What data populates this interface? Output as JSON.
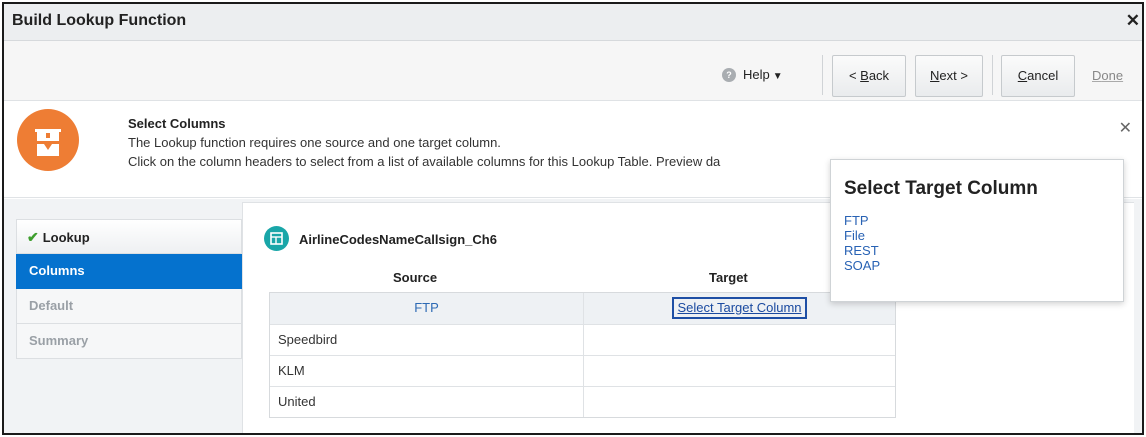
{
  "dialog": {
    "title": "Build Lookup Function",
    "close_glyph": "✕"
  },
  "toolbar": {
    "help_label": "Help",
    "back": {
      "accel": "B",
      "prefix": "< ",
      "rest": "ack"
    },
    "next": {
      "accel": "N",
      "rest": "ext >"
    },
    "cancel": {
      "accel": "C",
      "rest": "ancel"
    },
    "done": {
      "accel": "D",
      "rest": "one"
    }
  },
  "info": {
    "title": "Select Columns",
    "line1": "The Lookup function requires one source and one target column.",
    "line2": "Click on the column headers to select from a list of available columns for this Lookup Table. Preview da",
    "close_glyph": "✕",
    "badge_color": "#ee7d34"
  },
  "steps": [
    {
      "label": "Lookup",
      "state": "completed"
    },
    {
      "label": "Columns",
      "state": "active"
    },
    {
      "label": "Default",
      "state": "pending"
    },
    {
      "label": "Summary",
      "state": "pending"
    }
  ],
  "content": {
    "table_name": "AirlineCodesNameCallsign_Ch6",
    "source_header": "Source",
    "target_header": "Target",
    "source_column": "FTP",
    "target_column": "Select Target Column",
    "rows": [
      {
        "source": "Speedbird",
        "target": ""
      },
      {
        "source": "KLM",
        "target": ""
      },
      {
        "source": "United",
        "target": ""
      }
    ]
  },
  "popup": {
    "title": "Select Target Column",
    "options": [
      "FTP",
      "File",
      "REST",
      "SOAP"
    ]
  },
  "colors": {
    "accent": "#0572ce",
    "link": "#2862b4",
    "check": "#3e9e2e",
    "table_icon": "#19a6a8"
  }
}
